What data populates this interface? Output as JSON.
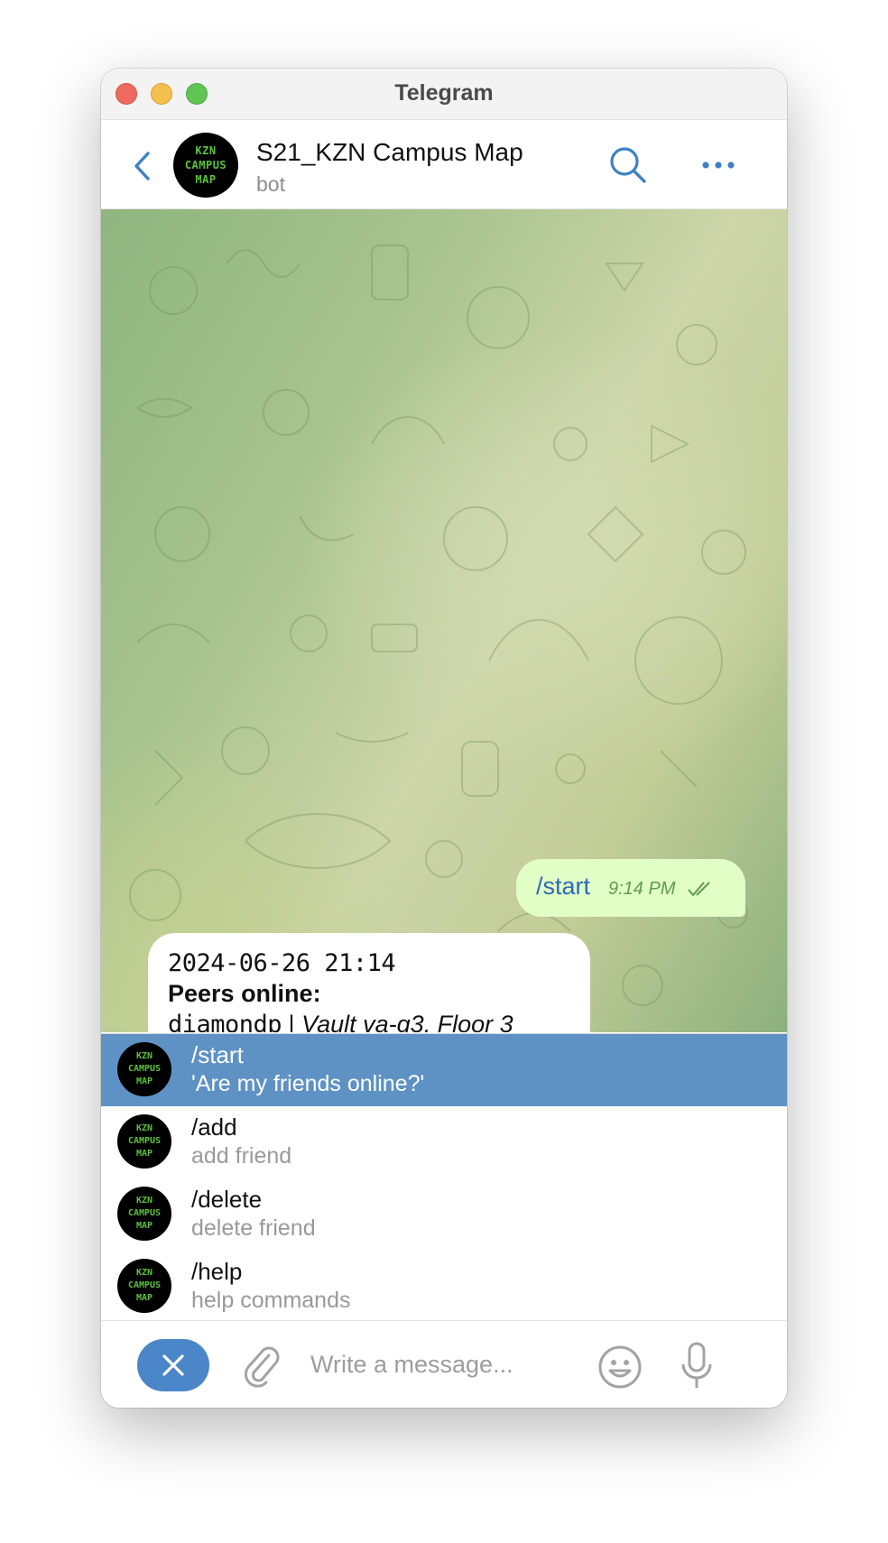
{
  "window": {
    "title": "Telegram"
  },
  "header": {
    "chat_title": "S21_KZN Campus Map",
    "chat_subtitle": "bot",
    "avatar_lines": [
      "KZN",
      "CAMPUS",
      "MAP"
    ]
  },
  "messages": {
    "outgoing": {
      "text": "/start",
      "time": "9:14 PM",
      "status": "read"
    },
    "incoming": {
      "line1": "2024-06-26 21:14",
      "line2": "Peers online:",
      "peer_login": "diamondp",
      "separator": " | ",
      "peer_location": "Vault va-g3, Floor 3"
    }
  },
  "commands": [
    {
      "name": "/start",
      "description": "'Are my friends online?'",
      "selected": true
    },
    {
      "name": "/add",
      "description": "add friend",
      "selected": false
    },
    {
      "name": "/delete",
      "description": "delete friend",
      "selected": false
    },
    {
      "name": "/help",
      "description": "help commands",
      "selected": false
    }
  ],
  "composer": {
    "placeholder": "Write a message...",
    "value": ""
  },
  "colors": {
    "accent": "#4a86c8",
    "selected_row": "#5e92c4",
    "outgoing_bubble": "#e1fec6",
    "avatar_text": "#5cc23d"
  }
}
